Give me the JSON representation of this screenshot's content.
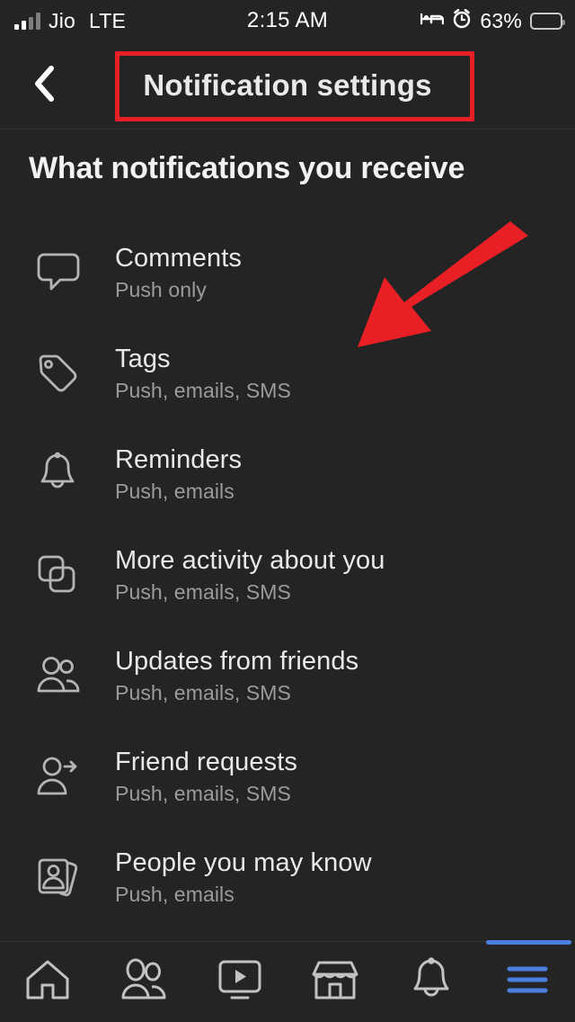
{
  "status_bar": {
    "carrier": "Jio",
    "network": "LTE",
    "time": "2:15 AM",
    "battery_percent": "63%",
    "battery_level": 63,
    "icons": [
      "signal-bars-icon",
      "bed-icon",
      "alarm-icon",
      "battery-icon"
    ]
  },
  "header": {
    "title": "Notification settings",
    "back_icon": "chevron-left-icon"
  },
  "section": {
    "heading": "What notifications you receive"
  },
  "list": [
    {
      "icon": "comment-bubble-icon",
      "title": "Comments",
      "subtitle": "Push only"
    },
    {
      "icon": "tag-icon",
      "title": "Tags",
      "subtitle": "Push, emails, SMS"
    },
    {
      "icon": "bell-icon",
      "title": "Reminders",
      "subtitle": "Push, emails"
    },
    {
      "icon": "stacked-squares-icon",
      "title": "More activity about you",
      "subtitle": "Push, emails, SMS"
    },
    {
      "icon": "two-people-icon",
      "title": "Updates from friends",
      "subtitle": "Push, emails, SMS"
    },
    {
      "icon": "person-arrow-icon",
      "title": "Friend requests",
      "subtitle": "Push, emails, SMS"
    },
    {
      "icon": "photo-cards-person-icon",
      "title": "People you may know",
      "subtitle": "Push, emails"
    }
  ],
  "tabbar": {
    "items": [
      {
        "icon": "home-icon",
        "label": "Home",
        "active": false
      },
      {
        "icon": "friends-icon",
        "label": "Friends",
        "active": false
      },
      {
        "icon": "watch-video-icon",
        "label": "Watch",
        "active": false
      },
      {
        "icon": "marketplace-store-icon",
        "label": "Marketplace",
        "active": false
      },
      {
        "icon": "bell-icon",
        "label": "Notifications",
        "active": false
      },
      {
        "icon": "hamburger-menu-icon",
        "label": "Menu",
        "active": true
      }
    ]
  },
  "annotations": {
    "highlight_box_color": "#e81f25",
    "arrow_color": "#e81f25",
    "highlight_target": "Notification settings",
    "arrow_target": "Tags"
  },
  "colors": {
    "background": "#242424",
    "title_text": "#e9e9e9",
    "subtitle_text": "#9b9b9b",
    "accent_blue": "#4a7fe0",
    "annotation_red": "#e81f25"
  }
}
